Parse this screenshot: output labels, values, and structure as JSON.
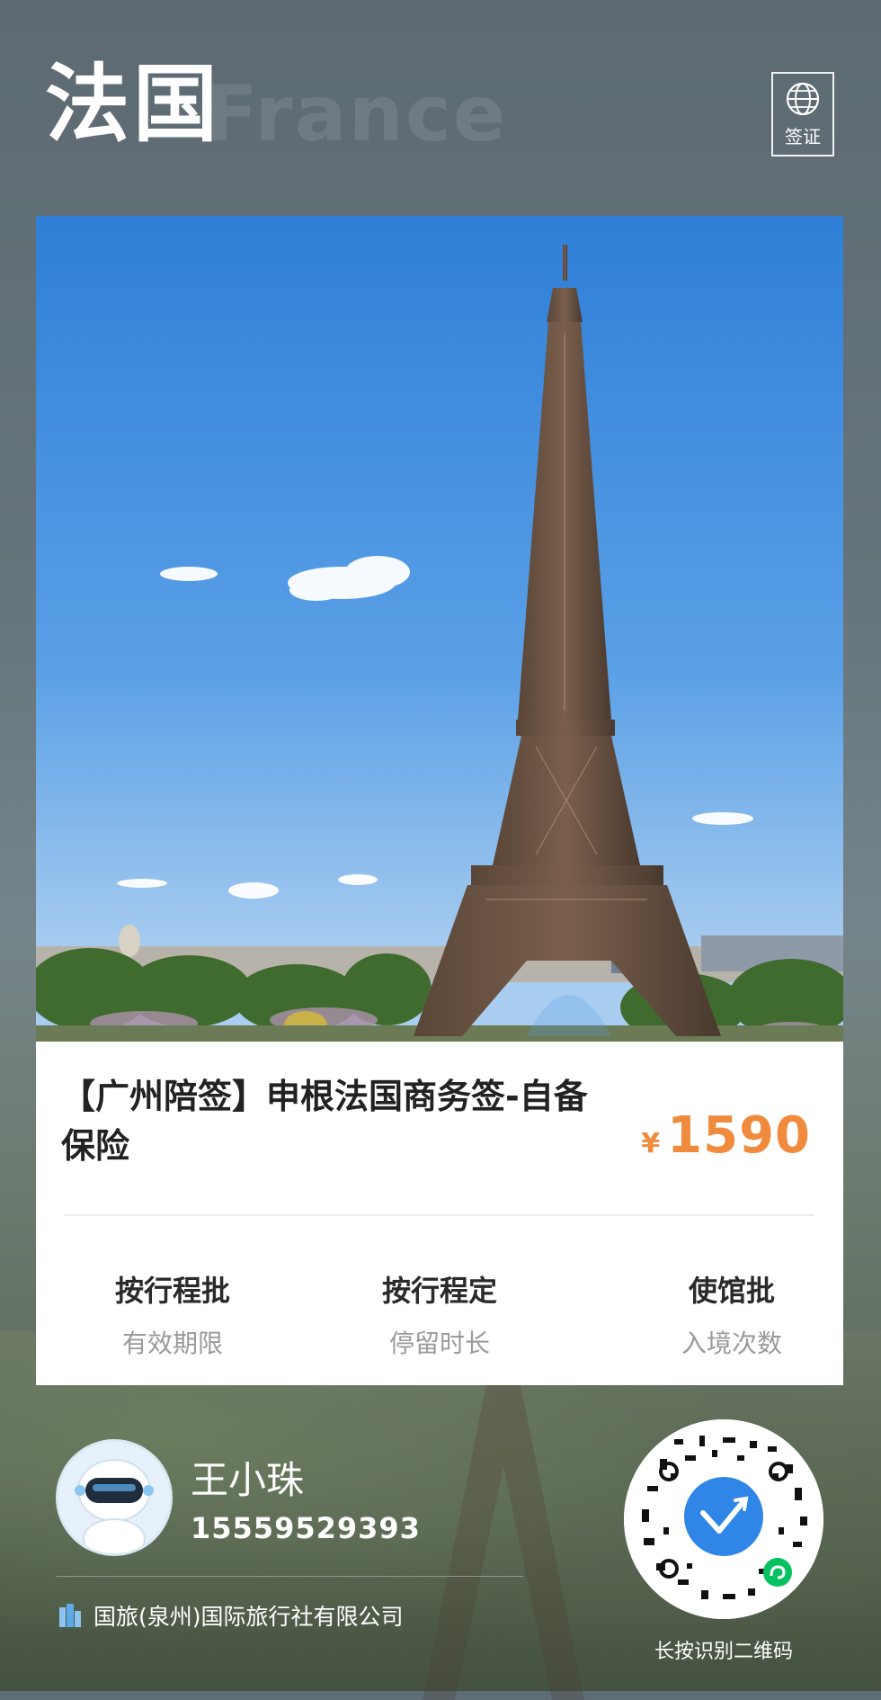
{
  "header": {
    "title": "法国",
    "watermark": "France",
    "visa_button": {
      "icon": "globe-icon",
      "label": "签证"
    }
  },
  "product": {
    "image": "eiffel-tower-photo",
    "title": "【广州陪签】申根法国商务签-自备保险",
    "currency": "¥",
    "price": "1590",
    "accent_color": "#f08a3c",
    "info": [
      {
        "value": "按行程批",
        "label": "有效期限"
      },
      {
        "value": "按行程定",
        "label": "停留时长"
      },
      {
        "value": "使馆批",
        "label": "入境次数"
      }
    ]
  },
  "agent": {
    "avatar": "robot-avatar",
    "name": "王小珠",
    "phone": "15559529393",
    "company_icon": "building-icon",
    "company": "国旅(泉州)国际旅行社有限公司"
  },
  "qr": {
    "icon": "mini-program-qr",
    "hint": "长按识别二维码"
  }
}
